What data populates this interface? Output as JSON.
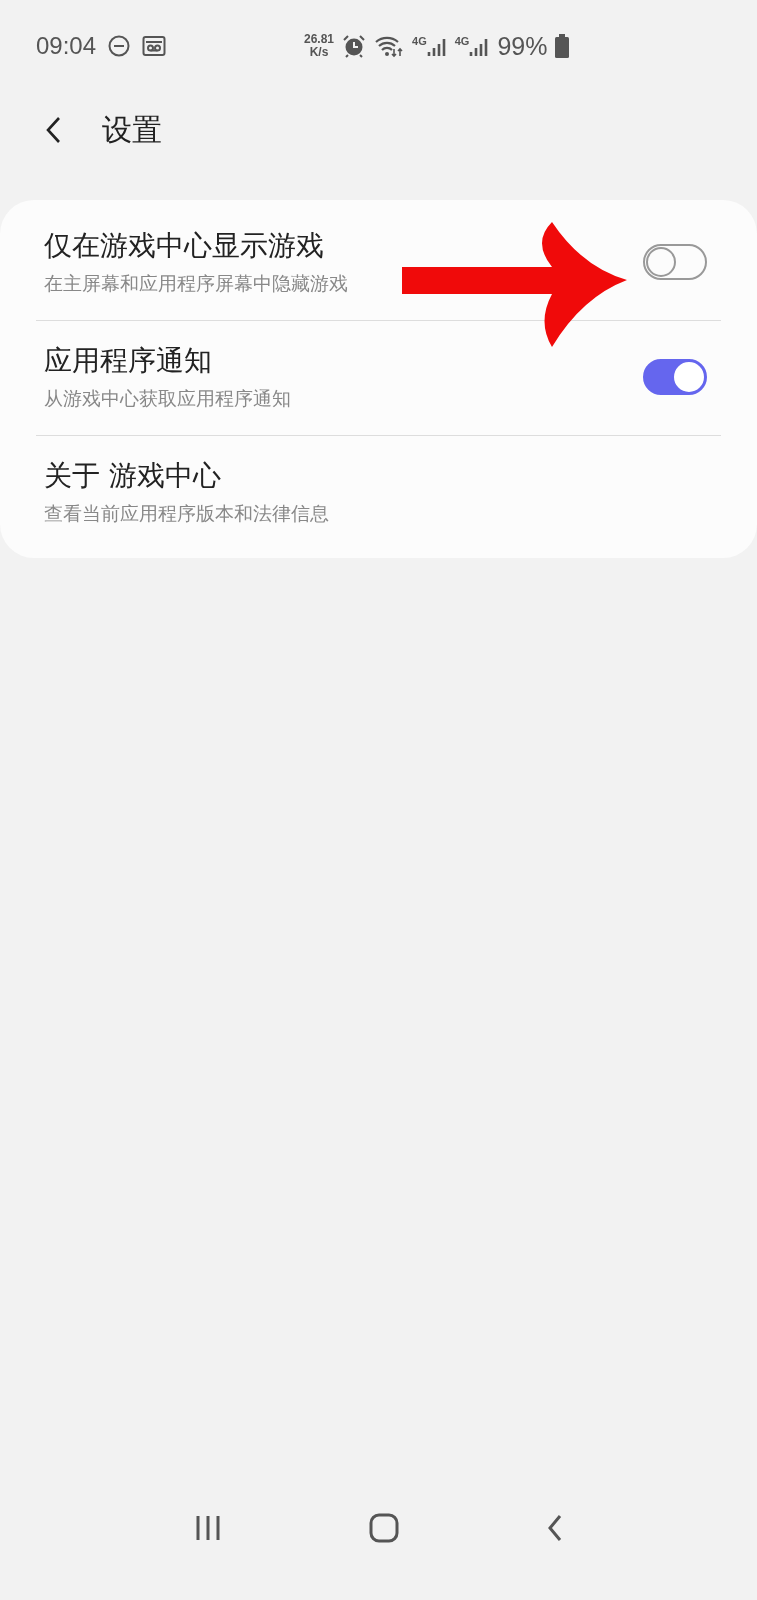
{
  "status_bar": {
    "time": "09:04",
    "speed_value": "26.81",
    "speed_unit": "K/s",
    "network_1": "4G",
    "network_2": "4G",
    "battery": "99%"
  },
  "header": {
    "title": "设置"
  },
  "settings": [
    {
      "kind": "toggle",
      "title": "仅在游戏中心显示游戏",
      "subtitle": "在主屏幕和应用程序屏幕中隐藏游戏",
      "on": false
    },
    {
      "kind": "toggle",
      "title": "应用程序通知",
      "subtitle": "从游戏中心获取应用程序通知",
      "on": true
    },
    {
      "kind": "info",
      "title": "关于 游戏中心",
      "subtitle": "查看当前应用程序版本和法律信息"
    }
  ]
}
